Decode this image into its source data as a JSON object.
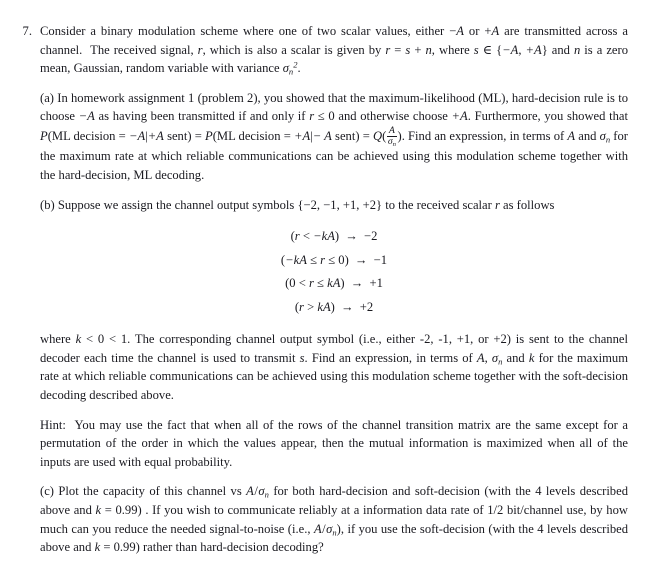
{
  "document": {
    "problem_number": "7.",
    "intro": {
      "text_parts": [
        "Consider a binary modulation scheme where one of two scalar values, either ",
        "−A",
        " or ",
        "+A",
        " are transmitted across a channel. The received signal, ",
        "r",
        ", which is also a scalar is given by ",
        "r = s + n",
        ", where ",
        "s ∈ {−A, +A}",
        " and ",
        "n",
        " is a zero mean, Gaussian, random variable with variance ",
        "σn²",
        "."
      ],
      "plain": "Consider a binary modulation scheme where one of two scalar values, either −A or +A are transmitted across a channel. The received signal, r, which is also a scalar is given by r = s + n, where s ∈ {−A,+A} and n is a zero mean, Gaussian, random variable with variance σn²."
    },
    "parts": [
      {
        "label": "(a)",
        "plain": "In homework assignment 1 (problem 2), you showed that the maximum-likelihood (ML), hard-decision rule is to choose −A as having been transmitted if and only if r ≤ 0 and otherwise choose +A. Furthermore, you showed that P(ML decision = −A|+A sent) = P(ML decision = +A|−A sent) = Q(A/σn). Find an expression, in terms of A and σn for the maximum rate at which reliable communications can be achieved using this modulation scheme together with the hard-decision, ML decoding."
      },
      {
        "label": "(b)",
        "plain": "Suppose we assign the channel output symbols {−2,−1,+1,+2} to the received scalar r as follows",
        "equations": [
          "(r < −kA) → −2",
          "(−kA ≤ r ≤ 0) → −1",
          "(0 < r ≤ kA) → +1",
          "(r > kA) → +2"
        ],
        "after_plain": "where k < 0 < 1. The corresponding channel output symbol (i.e., either -2, -1, +1, or +2) is sent to the channel decoder each time the channel is used to transmit s. Find an expression, in terms of A, σn and k for the maximum rate at which reliable communications can be achieved using this modulation scheme together with the soft-decision decoding described above."
      }
    ],
    "hint": {
      "label": "Hint:",
      "plain": "You may use the fact that when all of the rows of the channel transition matrix are the same except for a permutation of the order in which the values appear, then the mutual information is maximized when all of the inputs are used with equal probability."
    },
    "part_c": {
      "label": "(c)",
      "plain": "Plot the capacity of this channel vs A/σn for both hard-decision and soft-decision (with the 4 levels described above and k = 0.99) . If you wish to communicate reliably at a information data rate of 1/2 bit/channel use, by how much can you reduce the needed signal-to-noise (i.e., A/σn), if you use the soft-decision (with the 4 levels described above and k = 0.99) rather than hard-decision decoding?"
    },
    "symbols": {
      "sigma": "σ",
      "n_sub": "n",
      "A": "A",
      "k": "k",
      "r": "r",
      "s": "s",
      "in_set": "∈",
      "leq": "≤",
      "lt": "<",
      "gt": ">",
      "minus": "−",
      "arrow": "→",
      "k_value": "0.99",
      "rate": "1/2",
      "num_levels": "4",
      "output_symbols": "{−2,−1,+1,+2}",
      "input_set": "{−A,+A}"
    },
    "colors": {
      "background": "#ffffff",
      "text": "#1a1a20"
    }
  }
}
